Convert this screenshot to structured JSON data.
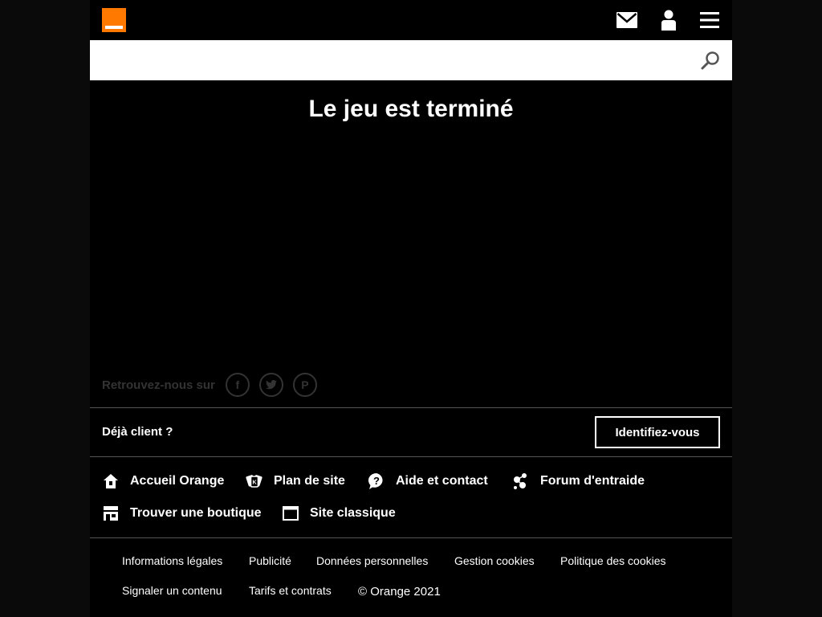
{
  "brand": {
    "color": "#ff7900"
  },
  "header": {
    "icons": [
      "mail-icon",
      "user-icon",
      "menu-icon"
    ]
  },
  "search": {
    "value": "",
    "icon": "search-icon"
  },
  "main": {
    "title": "Le jeu est terminé"
  },
  "social": {
    "label": "Retrouvez-nous sur",
    "networks": [
      "facebook",
      "twitter",
      "pinterest"
    ]
  },
  "login": {
    "question": "Déjà client ?",
    "button": "Identifiez-vous"
  },
  "footer_links": [
    {
      "label": "Accueil Orange",
      "icon": "home-icon"
    },
    {
      "label": "Plan de site",
      "icon": "sitemap-icon"
    },
    {
      "label": "Aide et contact",
      "icon": "help-icon"
    },
    {
      "label": "Forum d'entraide",
      "icon": "forum-icon"
    },
    {
      "label": "Trouver une boutique",
      "icon": "shop-icon"
    },
    {
      "label": "Site classique",
      "icon": "desktop-icon"
    }
  ],
  "legal": [
    "Informations légales",
    "Publicité",
    "Données personnelles",
    "Gestion cookies",
    "Politique des cookies",
    "Signaler un contenu",
    "Tarifs et contrats"
  ],
  "copyright": "© Orange 2021"
}
